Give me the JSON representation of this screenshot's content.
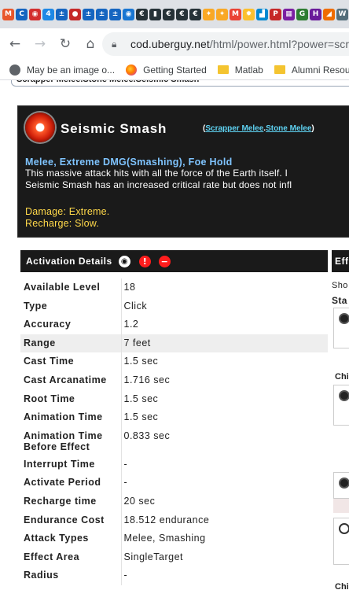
{
  "browser": {
    "tab_icons": [
      {
        "name": "m-favicon",
        "color": "#e8572c",
        "glyph": "M"
      },
      {
        "name": "c-favicon",
        "color": "#1565c0",
        "glyph": "C"
      },
      {
        "name": "circle-favicon",
        "color": "#d32f2f",
        "glyph": "◉"
      },
      {
        "name": "plus-favicon",
        "color": "#1e88e5",
        "glyph": "4"
      },
      {
        "name": "badge-favicon",
        "color": "#1565c0",
        "glyph": "±"
      },
      {
        "name": "red-favicon",
        "color": "#c62828",
        "glyph": "●"
      },
      {
        "name": "badge2-favicon",
        "color": "#1565c0",
        "glyph": "±"
      },
      {
        "name": "badge3-favicon",
        "color": "#1565c0",
        "glyph": "±"
      },
      {
        "name": "badge4-favicon",
        "color": "#1565c0",
        "glyph": "±"
      },
      {
        "name": "blue-circle-favicon",
        "color": "#1976d2",
        "glyph": "◉"
      },
      {
        "name": "e-favicon",
        "color": "#263238",
        "glyph": "€"
      },
      {
        "name": "dark-favicon",
        "color": "#263238",
        "glyph": "▮"
      },
      {
        "name": "e2-favicon",
        "color": "#263238",
        "glyph": "€"
      },
      {
        "name": "e3-favicon",
        "color": "#263238",
        "glyph": "€"
      },
      {
        "name": "e4-favicon",
        "color": "#263238",
        "glyph": "€"
      },
      {
        "name": "shield-favicon",
        "color": "#f9a825",
        "glyph": "✦"
      },
      {
        "name": "shield2-favicon",
        "color": "#f9a825",
        "glyph": "✦"
      },
      {
        "name": "gmail-favicon",
        "color": "#ea4335",
        "glyph": "M"
      },
      {
        "name": "bulb-favicon",
        "color": "#fbc02d",
        "glyph": "✹"
      },
      {
        "name": "chart-favicon",
        "color": "#0288d1",
        "glyph": "▟"
      },
      {
        "name": "pa-favicon",
        "color": "#c62828",
        "glyph": "P"
      },
      {
        "name": "grid-favicon",
        "color": "#7b1fa2",
        "glyph": "▦"
      },
      {
        "name": "g-favicon",
        "color": "#2e7d32",
        "glyph": "G"
      },
      {
        "name": "h-favicon",
        "color": "#6a1b9a",
        "glyph": "H"
      },
      {
        "name": "orange-favicon",
        "color": "#ef6c00",
        "glyph": "◢"
      },
      {
        "name": "w-favicon",
        "color": "#546e7a",
        "glyph": "W"
      }
    ],
    "url_host": "cod.uberguy.net",
    "url_path": "/html/power.html?power=scr",
    "bookmarks": [
      {
        "label": "May be an image o...",
        "icon": "globe"
      },
      {
        "label": "Getting Started",
        "icon": "fx"
      },
      {
        "label": "Matlab",
        "icon": "folder"
      },
      {
        "label": "Alumni Resou",
        "icon": "folder"
      }
    ]
  },
  "page": {
    "breadcrumb": "Scrapper Melee.Stone Melee.Seismic Smash",
    "power": {
      "name": "Seismic Smash",
      "set_open": "(",
      "set_link1": "Scrapper Melee",
      "set_dot": ".",
      "set_link2": "Stone Melee",
      "set_close": ")",
      "short_help": "Melee, Extreme DMG(Smashing), Foe Hold",
      "desc_line1": "This massive attack hits with all the force of the Earth itself. I",
      "desc_line2": "Seismic Smash has an increased critical rate but does not infl",
      "damage": "Damage: Extreme.",
      "recharge": "Recharge: Slow."
    },
    "activation": {
      "title": "Activation Details",
      "rows": [
        {
          "k": "Available Level",
          "v": "18"
        },
        {
          "k": "Type",
          "v": "Click"
        },
        {
          "k": "Accuracy",
          "v": "1.2"
        },
        {
          "k": "Range",
          "v": "7 feet"
        },
        {
          "k": "Cast Time",
          "v": "1.5 sec"
        },
        {
          "k": "Cast Arcanatime",
          "v": "1.716 sec"
        },
        {
          "k": "Root Time",
          "v": "1.5 sec"
        },
        {
          "k": "Animation Time",
          "v": "1.5 sec"
        },
        {
          "k": "Animation Time Before Effect",
          "v": "0.833 sec"
        },
        {
          "k": "Interrupt Time",
          "v": "-"
        },
        {
          "k": "Activate Period",
          "v": "-"
        },
        {
          "k": "Recharge time",
          "v": "20 sec"
        },
        {
          "k": "Endurance Cost",
          "v": "18.512 endurance"
        },
        {
          "k": "Attack Types",
          "v": "Melee, Smashing"
        },
        {
          "k": "Effect Area",
          "v": "SingleTarget"
        },
        {
          "k": "Radius",
          "v": "-"
        }
      ]
    },
    "effects": {
      "title": "Eff",
      "sho": "Sho",
      "sta": "Sta",
      "chi1": "Chi",
      "chi2": "Chi"
    }
  }
}
